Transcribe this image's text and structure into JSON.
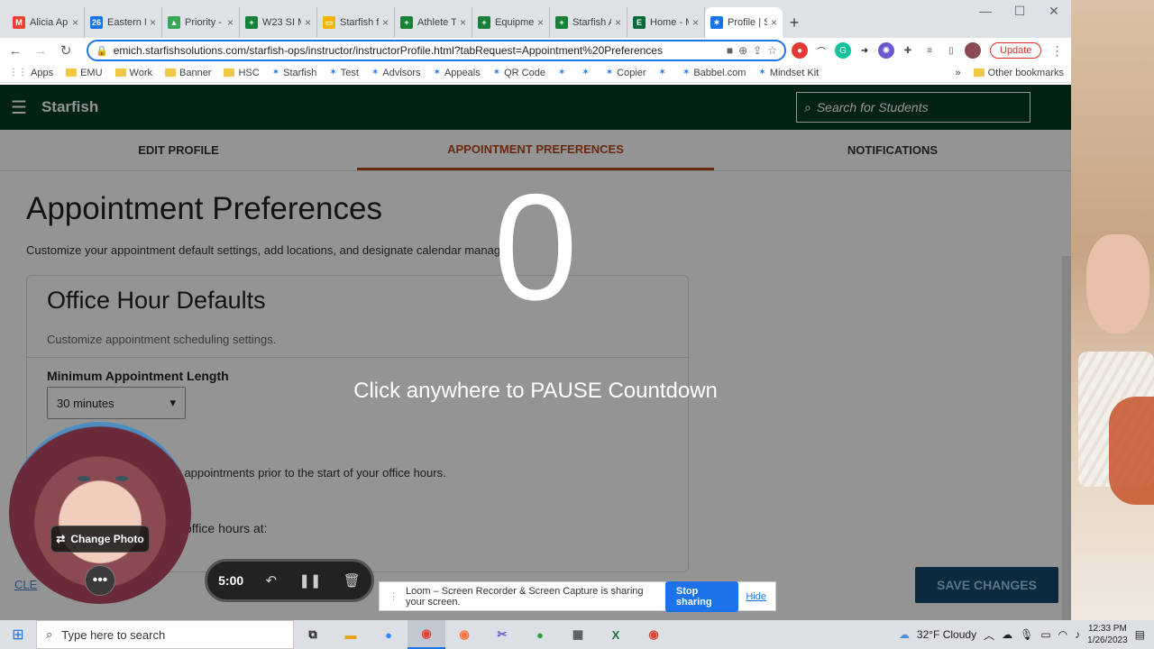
{
  "tabs": [
    {
      "label": "Alicia App",
      "icon": "gmail-icon",
      "color": "#ea4335",
      "glyph": "M"
    },
    {
      "label": "Eastern M",
      "icon": "calendar-icon",
      "color": "#1a73e8",
      "glyph": "26"
    },
    {
      "label": "Priority -",
      "icon": "drive-icon",
      "color": "#34a853",
      "glyph": "▲"
    },
    {
      "label": "W23 SI M",
      "icon": "sheets-icon",
      "color": "#188038",
      "glyph": "+"
    },
    {
      "label": "Starfish fo",
      "icon": "slides-icon",
      "color": "#f4b400",
      "glyph": "▭"
    },
    {
      "label": "Athlete Te",
      "icon": "sheets-icon",
      "color": "#188038",
      "glyph": "+"
    },
    {
      "label": "Equipmen",
      "icon": "sheets-icon",
      "color": "#188038",
      "glyph": "+"
    },
    {
      "label": "Starfish A",
      "icon": "sheets-icon",
      "color": "#188038",
      "glyph": "+"
    },
    {
      "label": "Home - M",
      "icon": "emu-icon",
      "color": "#046a38",
      "glyph": "E"
    },
    {
      "label": "Profile | S",
      "icon": "starfish-icon",
      "color": "#1a73e8",
      "glyph": "✶",
      "active": true
    }
  ],
  "url": "emich.starfishsolutions.com/starfish-ops/instructor/instructorProfile.html?tabRequest=Appointment%20Preferences",
  "update_label": "Update",
  "bookmarks": {
    "items": [
      "Apps",
      "EMU",
      "Work",
      "Banner",
      "HSC",
      "Starfish",
      "Test",
      "Advisors",
      "Appeals",
      "QR Code",
      "",
      "",
      "Copier",
      "",
      "Babbel.com",
      "Mindset Kit"
    ],
    "more": "»",
    "other": "Other bookmarks"
  },
  "starfish": {
    "brand": "Starfish",
    "search_placeholder": "Search for Students",
    "tabs": [
      "EDIT PROFILE",
      "APPOINTMENT PREFERENCES",
      "NOTIFICATIONS"
    ],
    "title": "Appointment Preferences",
    "subtitle": "Customize your appointment default settings, add locations, and designate calendar manag",
    "card_title": "Office Hour Defaults",
    "card_sub": "Customize appointment scheduling settings.",
    "min_label": "Minimum Appointment Length",
    "min_value": "30 minutes",
    "deadline_label": "S                  dline",
    "deadline_text": "                   ts to schedule appointments prior to the start of your office hours.",
    "hours_text": "office hours at:",
    "clear_label": "CLE",
    "save_label": "SAVE CHANGES"
  },
  "loom": {
    "count": "0",
    "hint": "Click anywhere to PAUSE Countdown",
    "change_photo": "Change Photo",
    "timer": "5:00",
    "share_text": "Loom – Screen Recorder & Screen Capture is sharing your screen.",
    "stop_label": "Stop sharing",
    "hide_label": "Hide"
  },
  "taskbar": {
    "search_placeholder": "Type here to search",
    "weather": "32°F  Cloudy",
    "time": "12:33 PM",
    "date": "1/26/2023"
  }
}
